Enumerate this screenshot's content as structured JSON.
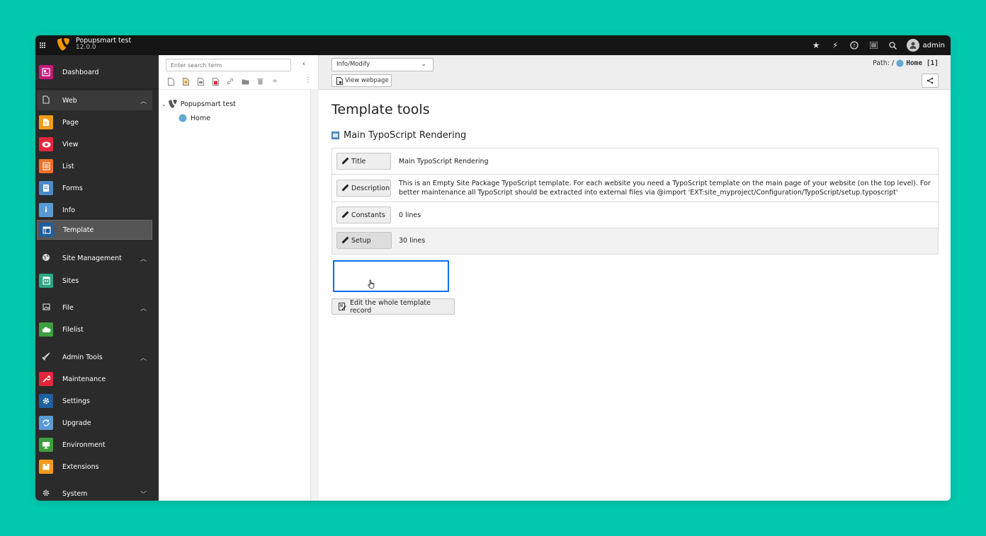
{
  "topbar": {
    "site_name": "Popupsmart test",
    "version": "12.0.0",
    "username": "admin",
    "icons": [
      "star-icon",
      "bolt-icon",
      "help-icon",
      "list-icon",
      "search-icon",
      "user-icon"
    ]
  },
  "sidebar": {
    "dashboard": "Dashboard",
    "web": "Web",
    "page": "Page",
    "view": "View",
    "list": "List",
    "forms": "Forms",
    "info": "Info",
    "template": "Template",
    "site_management": "Site Management",
    "sites": "Sites",
    "file": "File",
    "filelist": "Filelist",
    "admin_tools": "Admin Tools",
    "maintenance": "Maintenance",
    "settings": "Settings",
    "upgrade": "Upgrade",
    "environment": "Environment",
    "extensions": "Extensions",
    "system": "System",
    "colors": {
      "dashboard": "#c7197a",
      "page": "#f49b1d",
      "view": "#e3263c",
      "list": "#f07128",
      "forms": "#4a8ac9",
      "info": "#5b9bd5",
      "template": "#1d5fa0",
      "sites": "#2fa584",
      "filelist": "#3f9e3f",
      "maintenance": "#e3263c",
      "settings": "#1d5fa0",
      "upgrade": "#5b9bd5",
      "environment": "#3f9e3f",
      "extensions": "#f49b1d"
    }
  },
  "tree": {
    "search_placeholder": "Enter search term",
    "root": "Popupsmart test",
    "home": "Home"
  },
  "docheader": {
    "select_value": "Info/Modify",
    "view_webpage": "View webpage",
    "path_label": "Path: /",
    "path_page": "Home [1]"
  },
  "content": {
    "title": "Template tools",
    "subtitle": "Main TypoScript Rendering",
    "rows": [
      {
        "label": "Title",
        "value": "Main TypoScript Rendering"
      },
      {
        "label": "Description",
        "value": "This is an Empty Site Package TypoScript template. For each website you need a TypoScript template on the main page of your website (on the top level). For better maintenance all TypoScript should be extracted into external files via @import 'EXT:site_myproject/Configuration/TypoScript/setup.typoscript'"
      },
      {
        "label": "Constants",
        "value": "0 lines"
      },
      {
        "label": "Setup",
        "value": "30 lines"
      }
    ],
    "edit_button": "Edit the whole template record"
  }
}
